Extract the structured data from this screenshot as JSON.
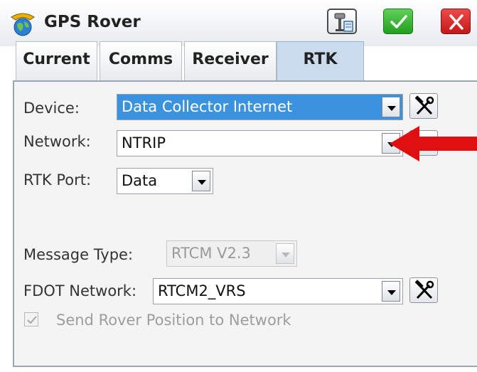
{
  "window": {
    "title": "GPS Rover"
  },
  "title_buttons": {
    "tool_icon": "antenna-settings-icon",
    "ok_icon": "checkmark-icon",
    "close_icon": "close-icon"
  },
  "tabs": [
    {
      "label": "Current",
      "active": false
    },
    {
      "label": "Comms",
      "active": false
    },
    {
      "label": "Receiver",
      "active": false
    },
    {
      "label": "RTK",
      "active": true
    }
  ],
  "form": {
    "device": {
      "label": "Device:",
      "value": "Data Collector Internet"
    },
    "network": {
      "label": "Network:",
      "value": "NTRIP"
    },
    "rtk_port": {
      "label": "RTK Port:",
      "value": "Data"
    },
    "message_type": {
      "label": "Message Type:",
      "value": "RTCM V2.3",
      "enabled": false
    },
    "fdot_network": {
      "label": "FDOT Network:",
      "value": "RTCM2_VRS"
    },
    "send_rover_position": {
      "label": "Send Rover Position to Network",
      "checked": true,
      "enabled": false
    }
  },
  "colors": {
    "selection": "#3b93df",
    "annotation_arrow": "#e01010",
    "ok_button": "#21a01e",
    "close_button": "#c41818"
  }
}
